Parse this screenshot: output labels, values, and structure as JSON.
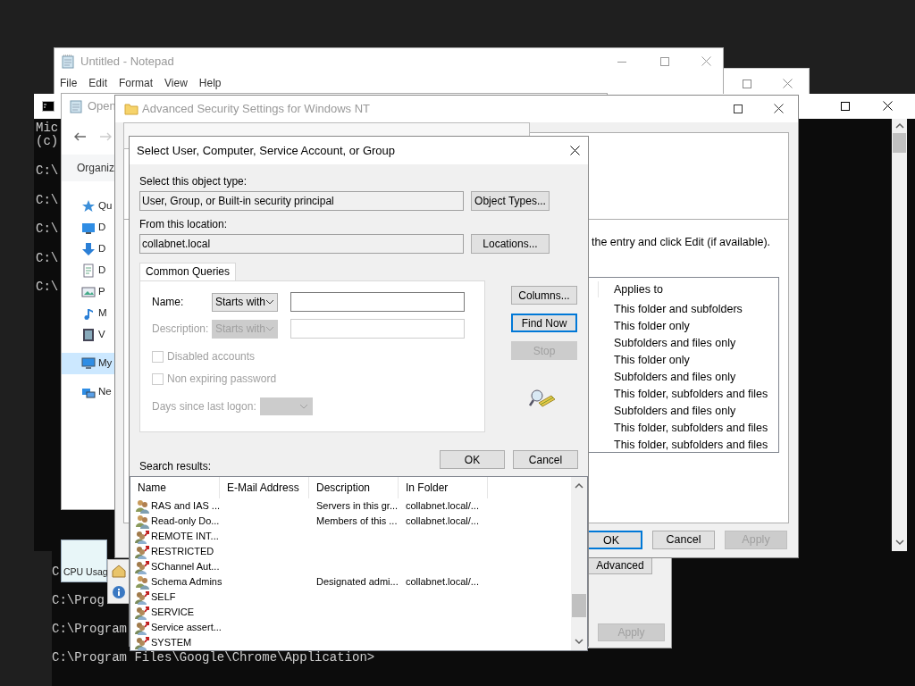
{
  "console_upper": {
    "header_lines": [
      "Mic",
      "(c)"
    ],
    "prompt_lines": [
      "C:\\",
      "C:\\",
      "C:\\",
      "C:\\",
      "C:\\"
    ]
  },
  "console_lower": {
    "prompt_lines": [
      "C",
      "C:\\Prog",
      "C:\\Program",
      "C:\\Program Files\\Google\\Chrome\\Application>"
    ]
  },
  "notepad": {
    "title": "Untitled - Notepad",
    "menu": [
      "File",
      "Edit",
      "Format",
      "View",
      "Help"
    ]
  },
  "explorer": {
    "title": "Open",
    "toolbar_item": "Organiz",
    "sidebar": [
      {
        "kind": "star",
        "label": "Qu",
        "selected": false
      },
      {
        "kind": "desktop",
        "label": "D",
        "selected": false
      },
      {
        "kind": "download",
        "label": "D",
        "selected": false
      },
      {
        "kind": "document",
        "label": "D",
        "selected": false
      },
      {
        "kind": "pictures",
        "label": "P",
        "selected": false
      },
      {
        "kind": "music",
        "label": "M",
        "selected": false
      },
      {
        "kind": "videos",
        "label": "V",
        "selected": false
      },
      {
        "kind": "computer",
        "label": "My",
        "selected": true
      },
      {
        "kind": "network",
        "label": "Ne",
        "selected": false
      }
    ]
  },
  "task_manager_fragment": {
    "label": "CPU Usag"
  },
  "permissions_window": {
    "buttons": [
      {
        "label": "Advanced",
        "disabled": false
      },
      {
        "label": "Apply",
        "disabled": true
      }
    ]
  },
  "advanced_security": {
    "title": "Advanced Security Settings for Windows NT",
    "instruction": "the entry and click Edit (if available).",
    "table": {
      "columns": [
        "Applies to"
      ],
      "rows": [
        "This folder and subfolders",
        "This folder only",
        "Subfolders and files only",
        "This folder only",
        "Subfolders and files only",
        "This folder, subfolders and files",
        "Subfolders and files only",
        "This folder, subfolders and files",
        "This folder, subfolders and files"
      ]
    },
    "buttons": [
      {
        "label": "OK",
        "default": true,
        "disabled": false
      },
      {
        "label": "Cancel",
        "default": false,
        "disabled": false
      },
      {
        "label": "Apply",
        "default": false,
        "disabled": true
      }
    ]
  },
  "dialog": {
    "title": "Select User, Computer, Service Account, or Group",
    "object_type": {
      "label": "Select this object type:",
      "value": "User, Group, or Built-in security principal",
      "button": "Object Types..."
    },
    "location": {
      "label": "From this location:",
      "value": "collabnet.local",
      "button": "Locations..."
    },
    "tab": {
      "label": "Common Queries",
      "selected": true
    },
    "queries": {
      "name": {
        "label": "Name:",
        "mode": "Starts with",
        "disabled": false
      },
      "description": {
        "label": "Description:",
        "mode": "Starts with",
        "disabled": true
      },
      "checkboxes": [
        {
          "label": "Disabled accounts",
          "checked": false,
          "disabled": true
        },
        {
          "label": "Non expiring password",
          "checked": false,
          "disabled": true
        }
      ],
      "days": {
        "label": "Days since last logon:",
        "disabled": true
      }
    },
    "side_buttons": [
      {
        "label": "Columns...",
        "default": false,
        "disabled": false
      },
      {
        "label": "Find Now",
        "default": true,
        "disabled": false
      },
      {
        "label": "Stop",
        "default": false,
        "disabled": true
      }
    ],
    "footer_buttons": [
      {
        "label": "OK",
        "default": false,
        "disabled": false
      },
      {
        "label": "Cancel",
        "default": false,
        "disabled": false
      }
    ],
    "results_label": "Search results:",
    "results": {
      "columns": [
        "Name",
        "E-Mail Address",
        "Description",
        "In Folder"
      ],
      "rows": [
        {
          "kind": "group",
          "name": "RAS and IAS ...",
          "description": "Servers in this gr...",
          "folder": "collabnet.local/..."
        },
        {
          "kind": "group",
          "name": "Read-only Do...",
          "description": "Members of this ...",
          "folder": "collabnet.local/..."
        },
        {
          "kind": "principal",
          "name": "REMOTE INT..."
        },
        {
          "kind": "principal",
          "name": "RESTRICTED"
        },
        {
          "kind": "principal",
          "name": "SChannel Aut..."
        },
        {
          "kind": "group",
          "name": "Schema Admins",
          "description": "Designated admi...",
          "folder": "collabnet.local/..."
        },
        {
          "kind": "principal",
          "name": "SELF"
        },
        {
          "kind": "principal",
          "name": "SERVICE"
        },
        {
          "kind": "principal",
          "name": "Service assert..."
        },
        {
          "kind": "principal",
          "name": "SYSTEM"
        }
      ]
    }
  }
}
